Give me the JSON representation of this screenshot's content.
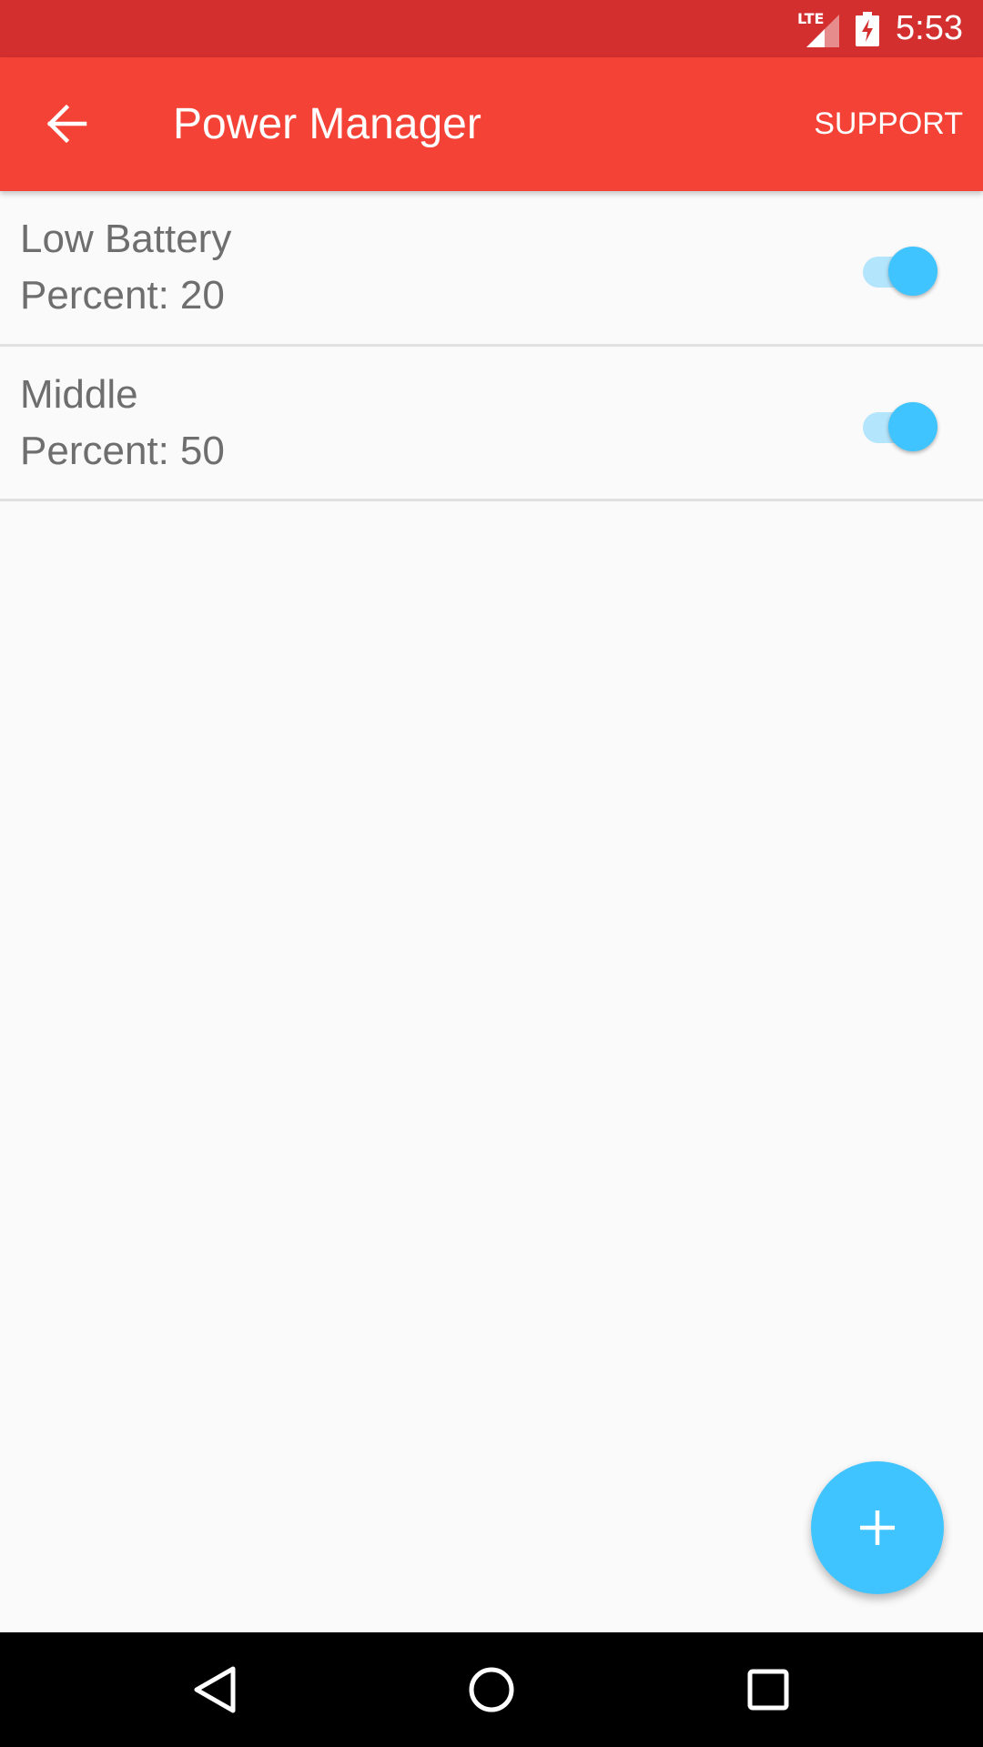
{
  "status_bar": {
    "network_label": "LTE",
    "time": "5:53",
    "icons": [
      "lte-signal-icon",
      "battery-charging-icon"
    ]
  },
  "app_bar": {
    "title": "Power Manager",
    "support_label": "SUPPORT",
    "back_icon": "arrow-back-icon"
  },
  "list": {
    "items": [
      {
        "title": "Low Battery",
        "sub_label": "Percent:",
        "value": "20",
        "enabled": true
      },
      {
        "title": "Middle",
        "sub_label": "Percent:",
        "value": "50",
        "enabled": true
      }
    ]
  },
  "fab": {
    "icon": "plus-icon"
  },
  "nav_bar": {
    "icons": [
      "back-triangle-icon",
      "home-circle-icon",
      "recents-square-icon"
    ]
  },
  "colors": {
    "status_bar": "#d32f2f",
    "app_bar": "#f44336",
    "accent": "#40c4ff",
    "accent_light": "#b3e5fc",
    "text_secondary": "#6e6e6e"
  }
}
